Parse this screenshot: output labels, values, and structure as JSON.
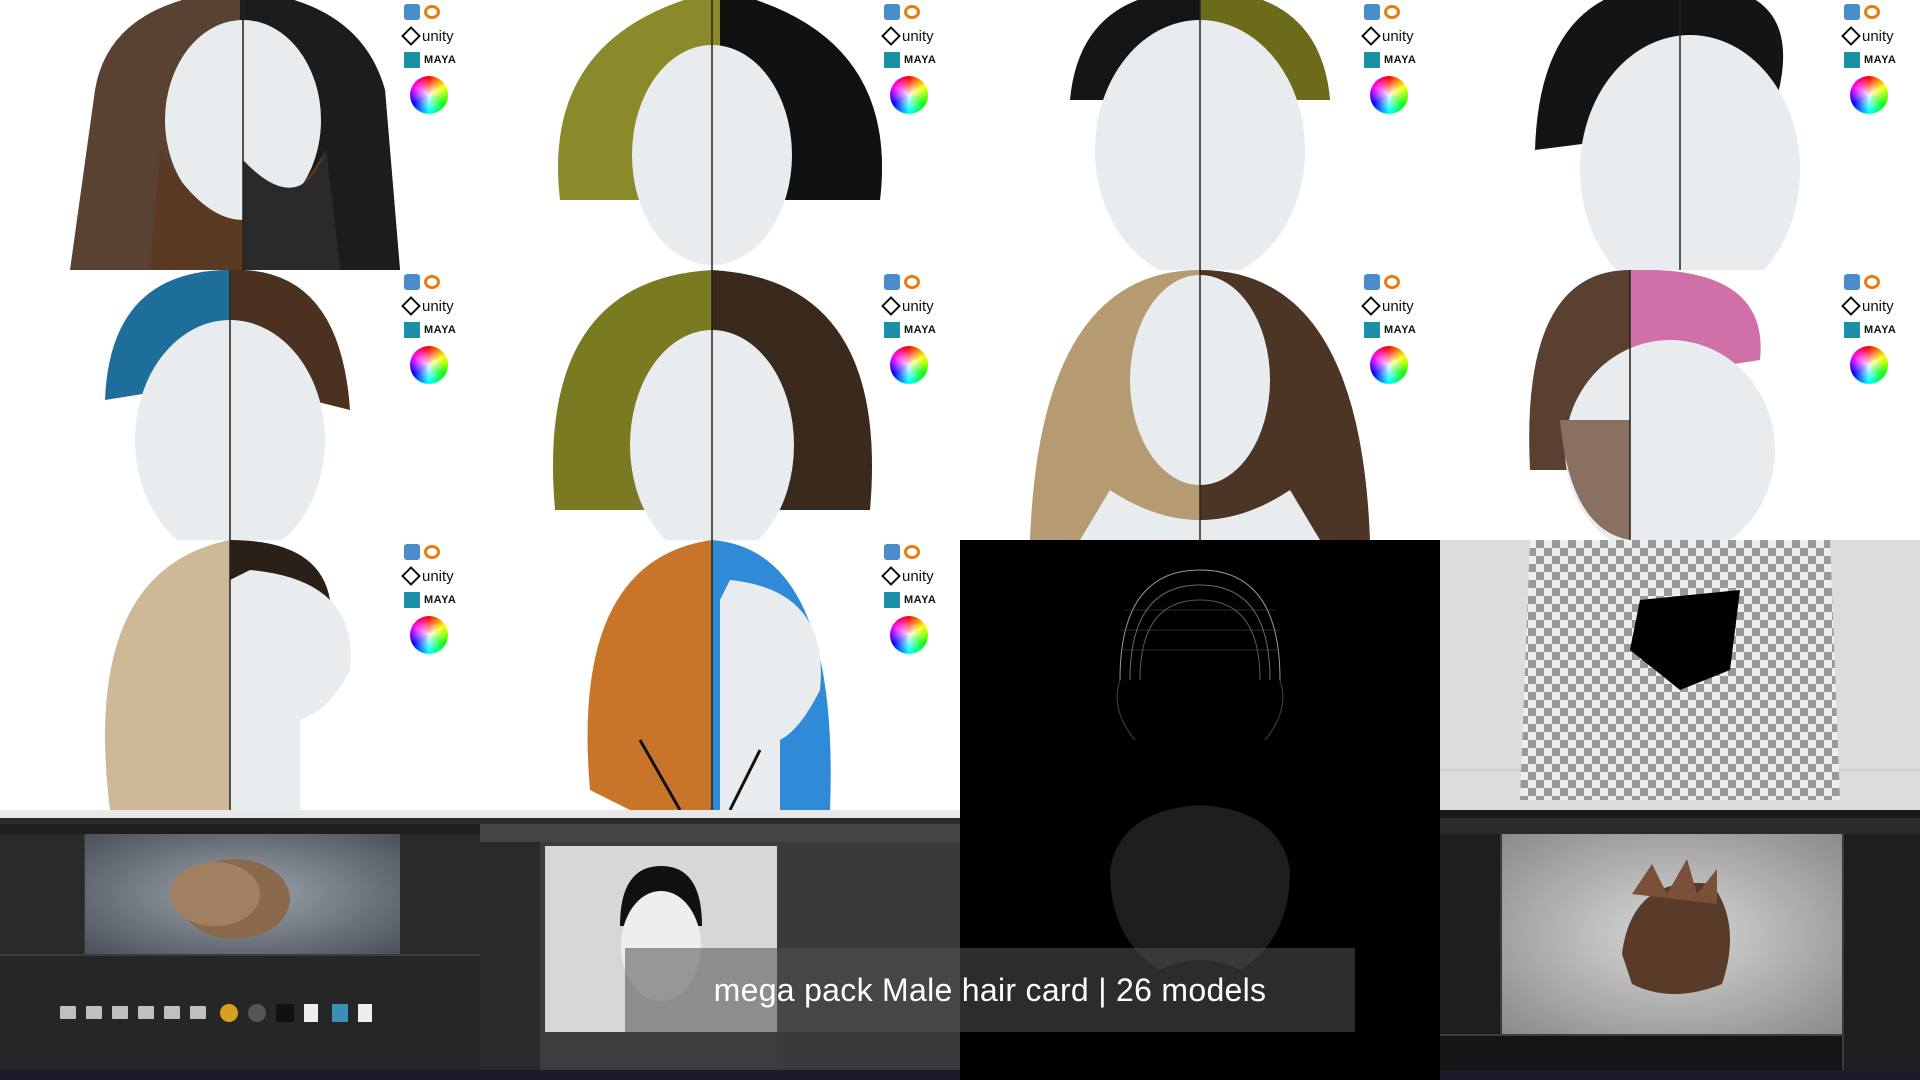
{
  "logo_badge": {
    "unity_label": "unity",
    "maya_label": "MAYA"
  },
  "tiles": [
    {
      "hair_left": "#5a4232",
      "hair_right": "#1c1c1c",
      "beard": true
    },
    {
      "hair_left": "#8a8a2a",
      "hair_right": "#111111",
      "beard": false
    },
    {
      "hair_left": "#151515",
      "hair_right": "#6b6b1a",
      "beard": false
    },
    {
      "hair_left": "#141414",
      "hair_right": "#141414",
      "beard": false
    },
    {
      "hair_left": "#1d6e9a",
      "hair_right": "#4a3120",
      "beard": false
    },
    {
      "hair_left": "#7a7a22",
      "hair_right": "#3a2a1e",
      "beard": false
    },
    {
      "hair_left": "#b59a72",
      "hair_right": "#4c3524",
      "beard": false
    },
    {
      "hair_left": "#5a4030",
      "hair_right": "#d070a8",
      "beard": false
    },
    {
      "hair_left": "#cdb898",
      "hair_right": "#2a2018",
      "beard": false
    },
    {
      "hair_left": "#c8752a",
      "hair_right": "#2f8bd8",
      "beard": false
    }
  ],
  "caption": "mega pack Male hair card | 26 models",
  "colors": {
    "skin": "#e9ecee",
    "divider": "#222222",
    "editor_bg": "#3c3c3c",
    "caption_bg": "rgba(80,80,80,0.55)"
  }
}
